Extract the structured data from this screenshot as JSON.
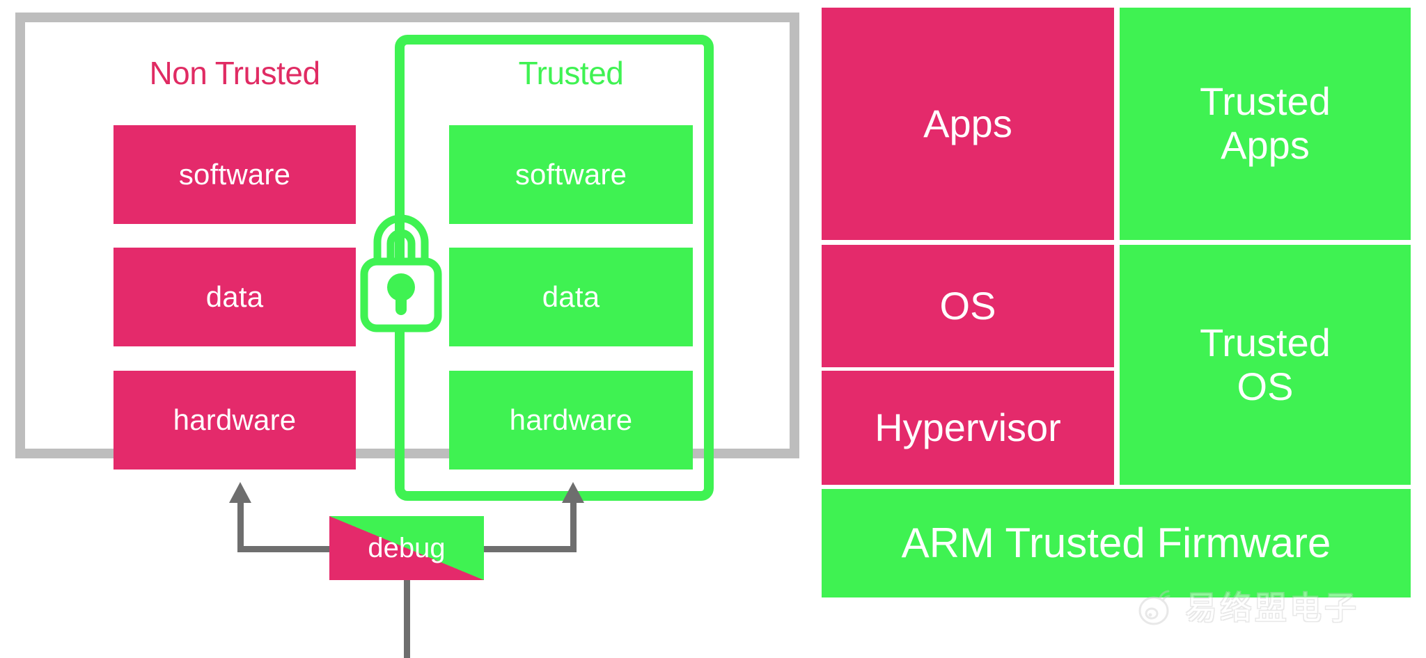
{
  "diagram": {
    "left_panel": {
      "columns": [
        {
          "title": "Non Trusted",
          "color": "#e02b63",
          "box_color": "#e42a6b",
          "layers": [
            "software",
            "data",
            "hardware"
          ]
        },
        {
          "title": "Trusted",
          "color": "#3ff252",
          "box_color": "#3ff252",
          "layers": [
            "software",
            "data",
            "hardware"
          ]
        }
      ],
      "lock_icon": "lock-icon",
      "debug": {
        "label": "debug",
        "left_color": "#e42a6b",
        "right_color": "#3ff252"
      },
      "frame_color": "#bdbdbd",
      "wire_color": "#6e6e6e"
    },
    "right_panel": {
      "cells": [
        {
          "label": "Apps",
          "type": "non-trusted"
        },
        {
          "label": "Trusted\nApps",
          "type": "trusted"
        },
        {
          "label": "OS",
          "type": "non-trusted"
        },
        {
          "label": "Hypervisor",
          "type": "non-trusted"
        },
        {
          "label": "Trusted\nOS",
          "type": "trusted"
        },
        {
          "label": "ARM Trusted Firmware",
          "type": "trusted"
        }
      ]
    },
    "watermark": {
      "text": "易络盟电子",
      "logo": "weibo-eye-icon"
    },
    "palette": {
      "pink": "#e42a6b",
      "green": "#3ff252",
      "gray": "#bdbdbd",
      "wire": "#6e6e6e",
      "white": "#ffffff"
    }
  }
}
